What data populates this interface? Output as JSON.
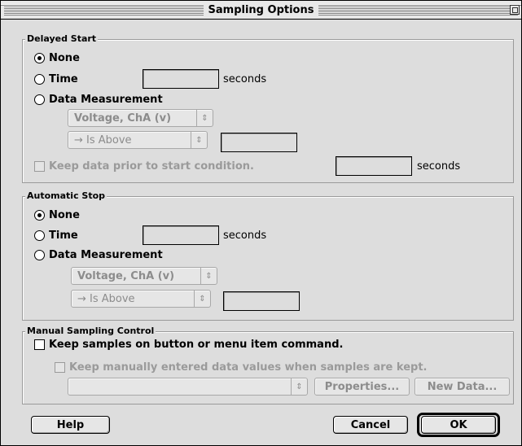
{
  "window": {
    "title": "Sampling Options"
  },
  "delayed_start": {
    "title": "Delayed Start",
    "none_label": "None",
    "time_label": "Time",
    "time_value": "",
    "time_units": "seconds",
    "data_measurement_label": "Data Measurement",
    "sensor_select": "Voltage, ChA (v)",
    "condition_select": "→ Is Above",
    "threshold_value": "",
    "keep_prior_label": "Keep data prior to start condition.",
    "keep_prior_value": "",
    "keep_prior_units": "seconds"
  },
  "automatic_stop": {
    "title": "Automatic Stop",
    "none_label": "None",
    "time_label": "Time",
    "time_value": "",
    "time_units": "seconds",
    "data_measurement_label": "Data Measurement",
    "sensor_select": "Voltage, ChA (v)",
    "condition_select": "→ Is Above",
    "threshold_value": ""
  },
  "manual_sampling": {
    "title": "Manual Sampling Control",
    "keep_samples_label": "Keep samples on button or menu item command.",
    "keep_manual_label": "Keep manually entered data values when samples are kept.",
    "data_select": "",
    "properties_label": "Properties...",
    "new_data_label": "New Data..."
  },
  "footer": {
    "help_label": "Help",
    "cancel_label": "Cancel",
    "ok_label": "OK"
  },
  "state": {
    "delayed_start_selected": "None",
    "automatic_stop_selected": "None",
    "keep_samples_checked": false,
    "keep_manual_checked": false
  }
}
